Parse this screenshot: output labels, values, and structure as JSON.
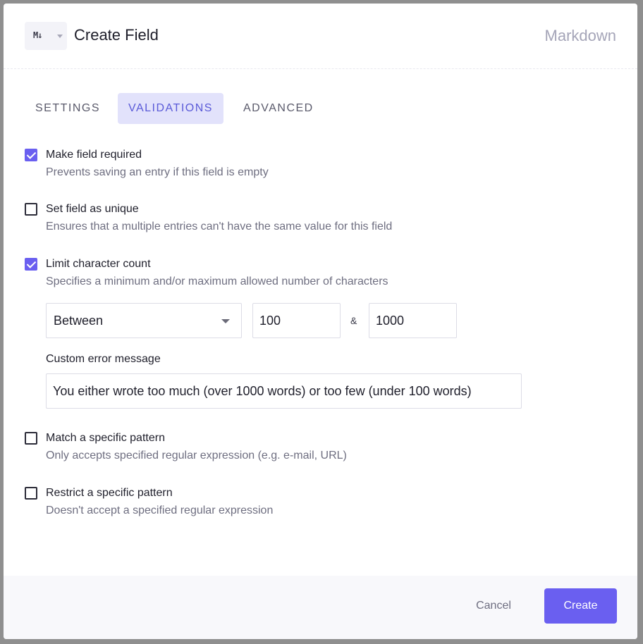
{
  "header": {
    "type_icon_text": "M↓",
    "title": "Create Field",
    "field_type": "Markdown"
  },
  "tabs": [
    {
      "label": "SETTINGS",
      "active": false
    },
    {
      "label": "VALIDATIONS",
      "active": true
    },
    {
      "label": "ADVANCED",
      "active": false
    }
  ],
  "validations": [
    {
      "label": "Make field required",
      "description": "Prevents saving an entry if this field is empty",
      "checked": true
    },
    {
      "label": "Set field as unique",
      "description": "Ensures that a multiple entries can't have the same value for this field",
      "checked": false
    },
    {
      "label": "Limit character count",
      "description": "Specifies a minimum and/or maximum allowed number of characters",
      "checked": true
    },
    {
      "label": "Match a specific pattern",
      "description": "Only accepts specified regular expression (e.g. e-mail, URL)",
      "checked": false
    },
    {
      "label": "Restrict a specific pattern",
      "description": "Doesn't accept a specified regular expression",
      "checked": false
    }
  ],
  "char_count": {
    "mode": "Between",
    "min": "100",
    "separator": "&",
    "max": "1000",
    "error_label": "Custom error message",
    "error_message": "You either wrote too much (over 1000 words) or too few (under 100 words)"
  },
  "footer": {
    "cancel_label": "Cancel",
    "create_label": "Create"
  },
  "colors": {
    "accent": "#6a5ff0",
    "active_tab_bg": "#e2e2fb"
  }
}
